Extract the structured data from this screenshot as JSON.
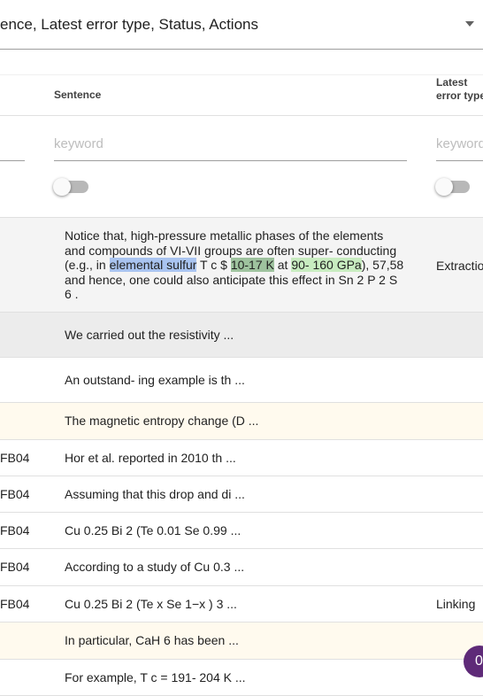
{
  "column_select": {
    "value": "ence, Latest error type, Status, Actions"
  },
  "headers": {
    "sentence": "Sentence",
    "latest_error_line1": "Latest",
    "latest_error_line2": "error type"
  },
  "filters": {
    "left_placeholder": "",
    "sentence_placeholder": "keyword",
    "error_placeholder": "keyword"
  },
  "rows": [
    {
      "left": "",
      "sentence_parts": [
        "Notice that, high-pressure metallic phases of the elements and compounds of VI-VII groups are often super- conducting (e.g., in ",
        "elemental sulfur",
        " T c $ ",
        "10-17 K",
        " at ",
        "90- 160 GPa",
        "), 57,58 and hence, one could also anticipate this effect in Sn 2 P 2 S 6 ."
      ],
      "error": "Extractio"
    },
    {
      "left": "",
      "sentence": "We carried out the resistivity ...",
      "error": ""
    },
    {
      "left": "",
      "sentence": "An outstand- ing example is th ...",
      "error": ""
    },
    {
      "left": "",
      "sentence": "The magnetic entropy change (D ...",
      "error": ""
    },
    {
      "left": "FB04",
      "sentence": "Hor et al. reported in 2010 th ...",
      "error": ""
    },
    {
      "left": "FB04",
      "sentence": "Assuming that this drop and di ...",
      "error": ""
    },
    {
      "left": "FB04",
      "sentence": "Cu 0.25 Bi 2 (Te 0.01 Se 0.99 ...",
      "error": ""
    },
    {
      "left": "FB04",
      "sentence": "According to a study of Cu 0.3 ...",
      "error": ""
    },
    {
      "left": "FB04",
      "sentence": "Cu 0.25 Bi 2 (Te x Se 1−x ) 3 ...",
      "error": "Linking"
    },
    {
      "left": "",
      "sentence": "In particular, CaH 6 has been ...",
      "error": ""
    },
    {
      "left": "",
      "sentence": "For example, T c = 191- 204 K ...",
      "error": ""
    }
  ],
  "fab": {
    "label": "0"
  },
  "colors": {
    "highlight_material": "#a9c4f0",
    "highlight_tc": "#9ec29e",
    "highlight_pressure": "#c8ecc0",
    "fab": "#5e2a78",
    "row_yellow": "#fffaee"
  },
  "icons": {
    "dropdown": "chevron-down-icon"
  }
}
